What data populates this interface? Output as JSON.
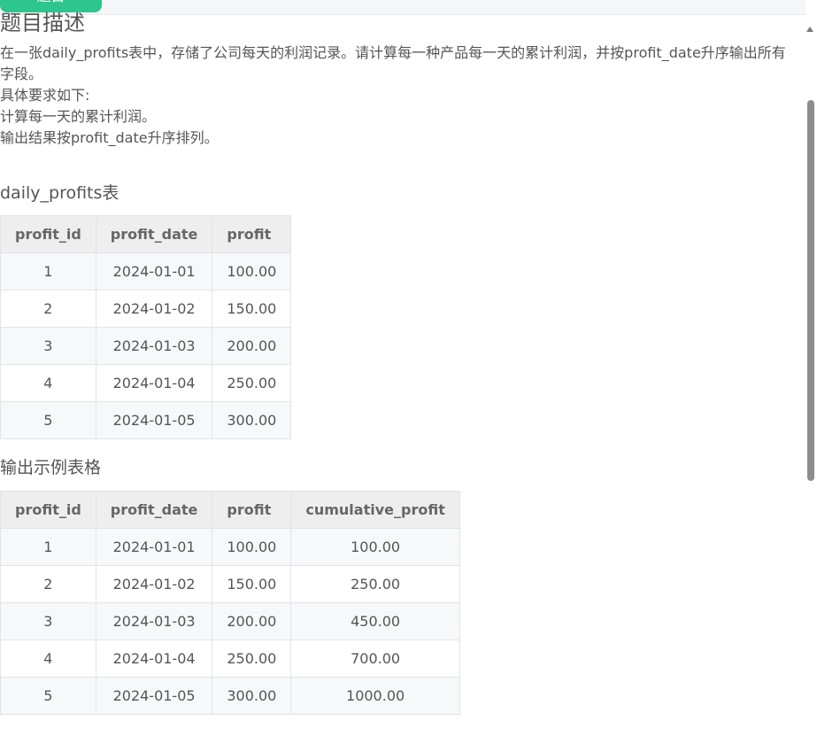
{
  "tabs": [
    "题目",
    "",
    "",
    ""
  ],
  "section_title": "题目描述",
  "description": [
    "在一张daily_profits表中，存储了公司每天的利润记录。请计算每一种产品每一天的累计利润，并按profit_date升序输出所有字段。",
    "具体要求如下:",
    "计算每一天的累计利润。",
    "输出结果按profit_date升序排列。"
  ],
  "table1": {
    "label": "daily_profits表",
    "headers": [
      "profit_id",
      "profit_date",
      "profit"
    ],
    "rows": [
      [
        "1",
        "2024-01-01",
        "100.00"
      ],
      [
        "2",
        "2024-01-02",
        "150.00"
      ],
      [
        "3",
        "2024-01-03",
        "200.00"
      ],
      [
        "4",
        "2024-01-04",
        "250.00"
      ],
      [
        "5",
        "2024-01-05",
        "300.00"
      ]
    ]
  },
  "table2": {
    "label": "输出示例表格",
    "headers": [
      "profit_id",
      "profit_date",
      "profit",
      "cumulative_profit"
    ],
    "rows": [
      [
        "1",
        "2024-01-01",
        "100.00",
        "100.00"
      ],
      [
        "2",
        "2024-01-02",
        "150.00",
        "250.00"
      ],
      [
        "3",
        "2024-01-03",
        "200.00",
        "450.00"
      ],
      [
        "4",
        "2024-01-04",
        "250.00",
        "700.00"
      ],
      [
        "5",
        "2024-01-05",
        "300.00",
        "1000.00"
      ]
    ]
  },
  "colors": {
    "accent": "#2ec58e",
    "header_bg": "#eeeeee",
    "stripe_bg": "#f6f8fa",
    "text": "#555555"
  }
}
